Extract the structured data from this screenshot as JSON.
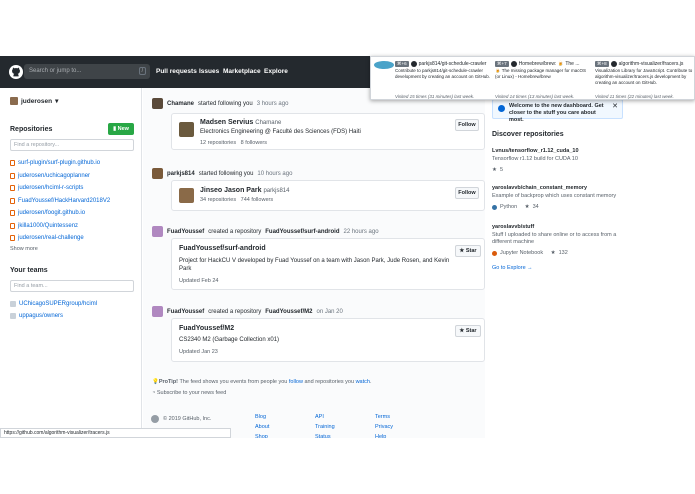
{
  "header": {
    "search_placeholder": "Search or jump to...",
    "search_shortcut": "/",
    "nav": [
      "Pull requests",
      "Issues",
      "Marketplace",
      "Explore"
    ]
  },
  "tab_previews": [
    {
      "badge": "⌘+6",
      "title": "parkjs814/git-schedule-crawler",
      "desc": "Contribute to parkjs814/git-schedule-crawler development by creating an account on GitHub.",
      "visited": "Visited 15 times (31 minutes) last week."
    },
    {
      "badge": "⌘+7",
      "title": "Homebrew/brew: 🍺 The ...",
      "desc": "🍺 The missing package manager for macOS (or Linux) - Homebrew/brew",
      "visited": "Visited 14 times (13 minutes) last week."
    },
    {
      "badge": "⌘+8",
      "title": "algorithm-visualizer/fracers.js",
      "desc": "Visualization Library for JavaScript. Contribute to algorithm-visualizer/tracers.js development by creating an account on GitHub.",
      "visited": "Visited 11 times (22 minutes) last week."
    }
  ],
  "sidebar": {
    "user": "juderosen",
    "repositories_title": "Repositories",
    "new_button": "New",
    "find_repo_placeholder": "Find a repository...",
    "repos": [
      "surf-plugin/surf-plugin.github.io",
      "juderosen/uchicagoplanner",
      "juderosen/hciml-r-scripts",
      "FuadYoussef/HackHarvard2018V2",
      "juderosen/foogit.github.io",
      "jkilla1000/Quintessenz",
      "juderosen/real-challenge"
    ],
    "show_more": "Show more",
    "teams_title": "Your teams",
    "find_team_placeholder": "Find a team...",
    "teams": [
      "UChicagoSUPERgroup/hciml",
      "uppagus/owners"
    ]
  },
  "feed": {
    "events": [
      {
        "actor": "Chamane",
        "action": "started following you",
        "time": "3 hours ago",
        "card": {
          "name": "Madsen Servius",
          "login": "Chamane",
          "line": "Electronics Engineering @ Faculté des Sciences (FDS) Haiti",
          "repos": "12 repositories",
          "followers": "8 followers",
          "button": "Follow"
        }
      },
      {
        "actor": "parkjs814",
        "action": "started following you",
        "time": "10 hours ago",
        "card": {
          "name": "Jinseo Jason Park",
          "login": "parkjs814",
          "repos": "34 repositories",
          "followers": "744 followers",
          "button": "Follow"
        }
      },
      {
        "actor": "FuadYoussef",
        "action": "created a repository",
        "target": "FuadYoussef/surf-android",
        "time": "22 hours ago",
        "card": {
          "name": "FuadYoussef/surf-android",
          "line": "Project for HackCU V developed by Fuad Youssef on a team with Jason Park, Jude Rosen, and Kevin Park",
          "updated": "Updated Feb 24",
          "button": "Star"
        }
      },
      {
        "actor": "FuadYoussef",
        "action": "created a repository",
        "target": "FuadYoussef/M2",
        "time": "on Jan 20",
        "card": {
          "name": "FuadYoussef/M2",
          "line": "CS2340 M2 (Garbage Collection x01)",
          "updated": "Updated Jan 23",
          "button": "Star"
        }
      }
    ],
    "protip_label": "ProTip!",
    "protip_text": " The feed shows you events from people you ",
    "protip_follow": "follow",
    "protip_and": " and repositories you ",
    "protip_watch": "watch",
    "protip_end": ".",
    "subscribe": "Subscribe to your news feed"
  },
  "right": {
    "welcome": "Welcome to the new dashboard. Get closer to the stuff you care about most.",
    "discover_title": "Discover repositories",
    "repos": [
      {
        "name": "Lvnus/tensorflow_r1.12_cuda_10",
        "desc": "Tensorflow r1.12 build for CUDA 10",
        "stars": "5",
        "lang": ""
      },
      {
        "name": "yaroslavvb/chain_constant_memory",
        "desc": "Example of backprop which uses constant memory",
        "stars": "34",
        "lang": "Python",
        "color": "#3572A5"
      },
      {
        "name": "yaroslavvb/stuff",
        "desc": "Stuff I uploaded to share online or to access from a different machine",
        "stars": "132",
        "lang": "Jupyter Notebook",
        "color": "#DA5B0B"
      }
    ],
    "explore_link": "Go to Explore →"
  },
  "footer": {
    "copyright": "© 2019 GitHub, Inc.",
    "col1": [
      "Blog",
      "About",
      "Shop"
    ],
    "col2": [
      "API",
      "Training",
      "Status"
    ],
    "col3": [
      "Terms",
      "Privacy",
      "Help"
    ]
  },
  "status_url": "https://github.com/algorithm-visualizer/tracers.js"
}
